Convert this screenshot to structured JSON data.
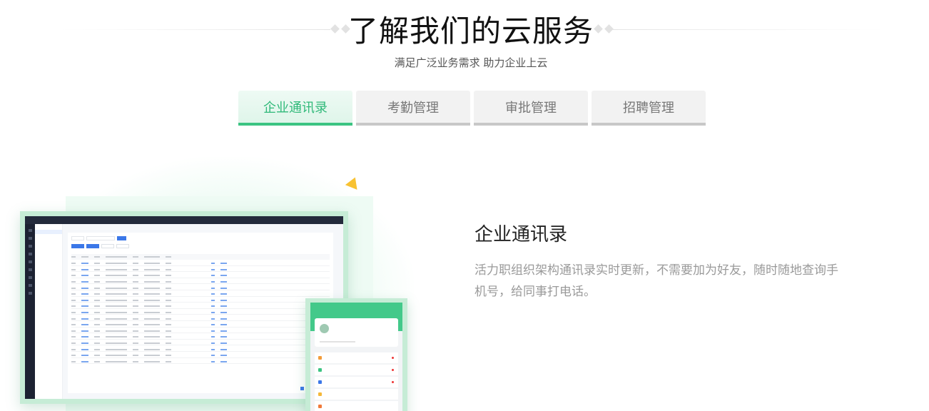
{
  "header": {
    "title": "了解我们的云服务",
    "subtitle": "满足广泛业务需求 助力企业上云"
  },
  "tabs": [
    {
      "label": "企业通讯录",
      "active": true
    },
    {
      "label": "考勤管理",
      "active": false
    },
    {
      "label": "审批管理",
      "active": false
    },
    {
      "label": "招聘管理",
      "active": false
    }
  ],
  "feature": {
    "title": "企业通讯录",
    "description": "活力职组织架构通讯录实时更新，不需要加为好友，随时随地查询手机号，给同事打电话。"
  },
  "colors": {
    "accent": "#3cc482",
    "accent_text": "#2fb979",
    "tab_inactive_bg": "#f2f2f2",
    "desc_text": "#9a9a9a"
  }
}
